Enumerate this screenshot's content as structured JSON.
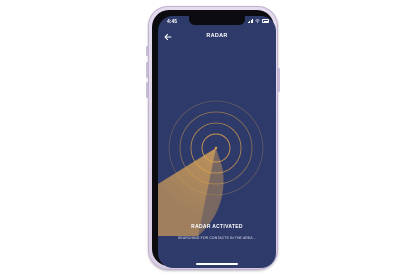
{
  "status_bar": {
    "time": "4:45"
  },
  "header": {
    "title": "RADAR",
    "back_icon": "arrow-left-icon"
  },
  "radar": {
    "ring_count": 4,
    "accent_color": "#e0a44a",
    "sweep_color": "#c79a5a"
  },
  "status": {
    "title": "RADAR ACTIVATED",
    "subtitle": "SEARCHING FOR CONTACTS IN THE AREA..."
  },
  "colors": {
    "screen_background": "#2e3a6a",
    "frame": "#d9cde6",
    "text": "#ffffff"
  }
}
